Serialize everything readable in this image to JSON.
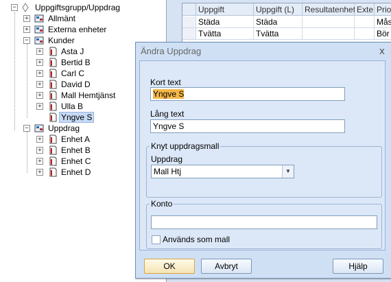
{
  "tree": {
    "root": {
      "label": "Uppgiftsgrupp/Uppdrag"
    },
    "items": [
      {
        "label": "Allmänt"
      },
      {
        "label": "Externa enheter"
      },
      {
        "label": "Kunder"
      },
      {
        "label": "Asta J"
      },
      {
        "label": "Bertid B"
      },
      {
        "label": "Carl C"
      },
      {
        "label": "David D"
      },
      {
        "label": "Mall Hemtjänst"
      },
      {
        "label": "Ulla B"
      },
      {
        "label": "Yngve S"
      },
      {
        "label": "Uppdrag"
      },
      {
        "label": "Enhet A"
      },
      {
        "label": "Enhet B"
      },
      {
        "label": "Enhet C"
      },
      {
        "label": "Enhet D"
      }
    ]
  },
  "grid": {
    "columns": [
      "Uppgift",
      "Uppgift (L)",
      "Resultatenhet",
      "Exte",
      "Prior"
    ],
    "rows": [
      [
        "Städa",
        "Städa",
        "",
        "",
        "Mås"
      ],
      [
        "Tvätta",
        "Tvätta",
        "",
        "",
        "Bör"
      ]
    ]
  },
  "dialog": {
    "title": "Ändra  Uppdrag",
    "close": "x",
    "kort_text_label": "Kort text",
    "kort_text_value": "Yngve S",
    "lang_text_label": "Lång text",
    "lang_text_value": "Yngve S",
    "knyt_group": "Knyt uppdragsmall",
    "uppdrag_label": "Uppdrag",
    "uppdrag_value": "Mall Htj",
    "konto_group": "Konto",
    "konto_value": "",
    "anvands_label": "Används som mall",
    "ok": "OK",
    "avbryt": "Avbryt",
    "hjalp": "Hjälp"
  },
  "colors": {
    "selection": "#c6daf5",
    "highlight": "#f5b74a",
    "dialog_bg": "#cfe0f5"
  }
}
